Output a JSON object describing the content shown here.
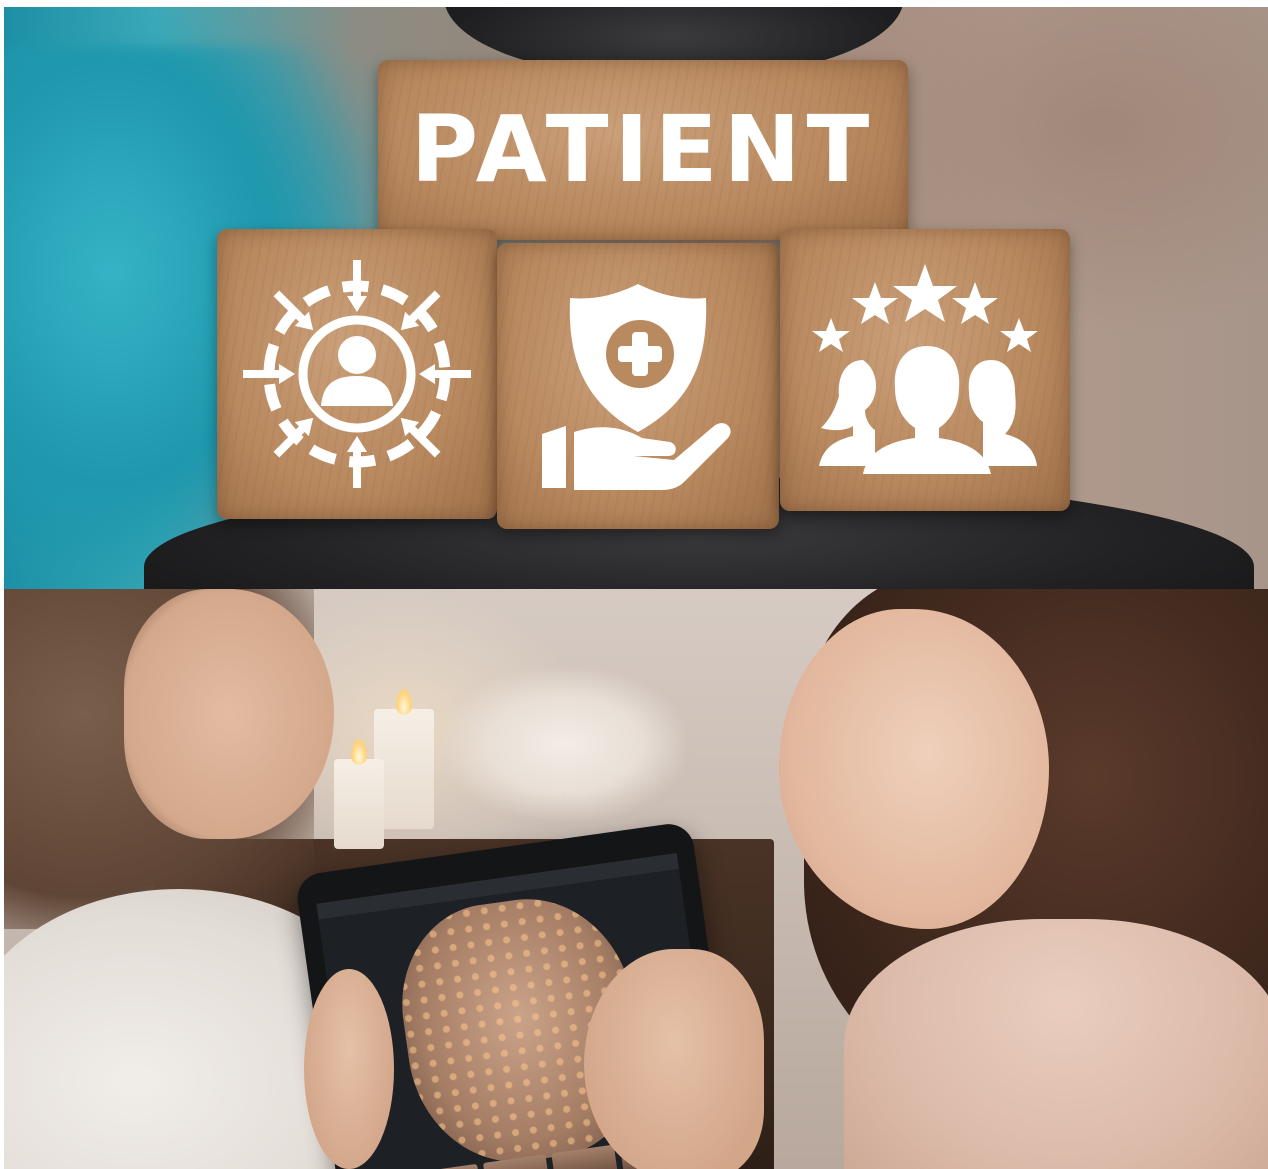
{
  "top_photo": {
    "word_block": {
      "text": "PATIENT"
    },
    "icon_blocks": [
      {
        "icon": "person-target-arrows-icon"
      },
      {
        "icon": "hand-shield-medical-cross-icon"
      },
      {
        "icon": "people-five-stars-icon"
      }
    ],
    "colors": {
      "wood": "#b9895f",
      "glyph": "#ffffff",
      "glove": "#222224",
      "background_teal": "#2aa3b8"
    }
  },
  "bottom_photo": {
    "scene": "skin-analysis-tablet-consultation",
    "colors": {
      "wall": "#c9bcb3",
      "tablet": "#141516",
      "cabinet": "#3a281d"
    }
  }
}
